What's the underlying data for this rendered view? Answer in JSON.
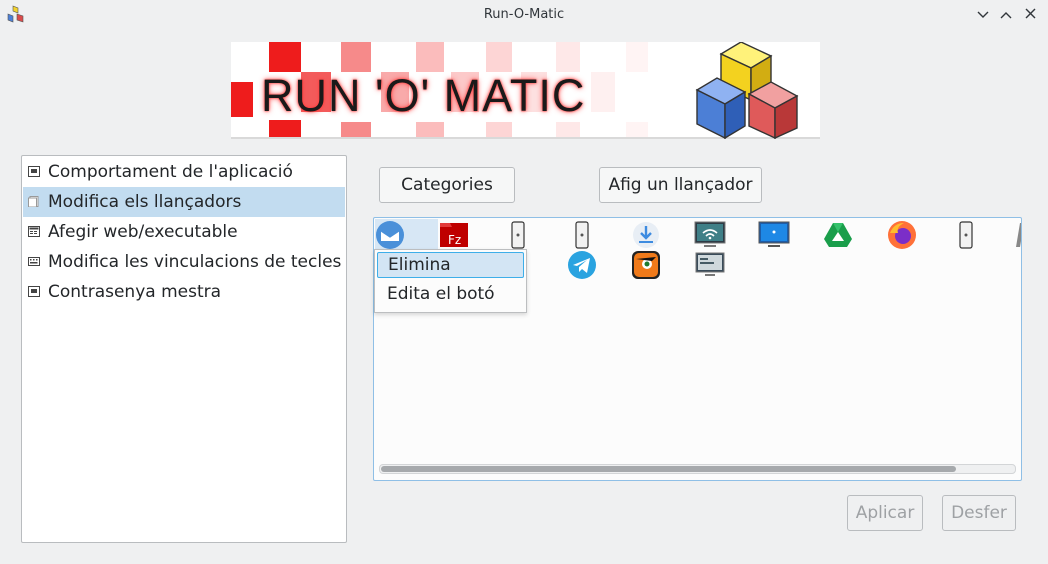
{
  "window": {
    "title": "Run-O-Matic"
  },
  "banner": {
    "text": "RUN 'O' MATIC"
  },
  "sidebar": {
    "items": [
      {
        "label": "Comportament de l'aplicació",
        "icon": "app-behavior-icon"
      },
      {
        "label": "Modifica els llançadors",
        "icon": "launchers-icon",
        "selected": true
      },
      {
        "label": "Afegir web/executable",
        "icon": "add-web-icon"
      },
      {
        "label": "Modifica les vinculacions de tecles",
        "icon": "keyboard-icon"
      },
      {
        "label": "Contrasenya mestra",
        "icon": "master-password-icon"
      }
    ]
  },
  "toolbar": {
    "categories_label": "Categories",
    "add_launcher_label": "Afig un llançador"
  },
  "context_menu": {
    "delete_label": "Elimina",
    "edit_label": "Edita el botó"
  },
  "actions": {
    "apply_label": "Aplicar",
    "undo_label": "Desfer"
  },
  "launchers": {
    "row1": [
      "mail-icon",
      "filezilla-icon",
      "phone-icon",
      "phone-icon",
      "download-icon",
      "wifi-monitor-icon",
      "remote-desktop-icon",
      "drive-icon",
      "firefox-icon",
      "phone-icon",
      "partial-icon"
    ],
    "row2": [
      "app-icon",
      "telegram-icon",
      "bird-app-icon",
      "monitor-icon"
    ]
  },
  "colors": {
    "accent": "#3daee9",
    "selection": "#c2dcf0"
  }
}
